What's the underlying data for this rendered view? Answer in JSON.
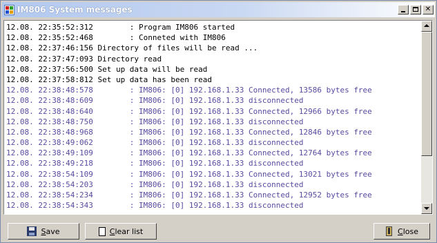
{
  "window": {
    "title": "IM806 System messages"
  },
  "log": {
    "lines": [
      {
        "text": "12.08. 22:35:52:312        : Program IM806 started",
        "color": "black"
      },
      {
        "text": "12.08. 22:35:52:468        : Conneted with IM806",
        "color": "black"
      },
      {
        "text": "12.08. 22:37:46:156 Directory of files will be read ...",
        "color": "black"
      },
      {
        "text": "12.08. 22:37:47:093 Directory read",
        "color": "black"
      },
      {
        "text": "12.08. 22:37:56:500 Set up data will be read",
        "color": "black"
      },
      {
        "text": "12.08. 22:37:58:812 Set up data has been read",
        "color": "black"
      },
      {
        "text": "12.08. 22:38:48:578        : IM806: [0] 192.168.1.33 Connected, 13586 bytes free",
        "color": "purple"
      },
      {
        "text": "12.08. 22:38:48:609        : IM806: [0] 192.168.1.33 disconnected",
        "color": "purple"
      },
      {
        "text": "12.08. 22:38:48:640        : IM806: [0] 192.168.1.33 Connected, 12966 bytes free",
        "color": "purple"
      },
      {
        "text": "12.08. 22:38:48:750        : IM806: [0] 192.168.1.33 disconnected",
        "color": "purple"
      },
      {
        "text": "12.08. 22:38:48:968        : IM806: [0] 192.168.1.33 Connected, 12846 bytes free",
        "color": "purple"
      },
      {
        "text": "12.08. 22:38:49:062        : IM806: [0] 192.168.1.33 disconnected",
        "color": "purple"
      },
      {
        "text": "12.08. 22:38:49:109        : IM806: [0] 192.168.1.33 Connected, 12764 bytes free",
        "color": "purple"
      },
      {
        "text": "12.08. 22:38:49:218        : IM806: [0] 192.168.1.33 disconnected",
        "color": "purple"
      },
      {
        "text": "12.08. 22:38:54:109        : IM806: [0] 192.168.1.33 Connected, 13021 bytes free",
        "color": "purple"
      },
      {
        "text": "12.08. 22:38:54:203        : IM806: [0] 192.168.1.33 disconnected",
        "color": "purple"
      },
      {
        "text": "12.08. 22:38:54:234        : IM806: [0] 192.168.1.33 Connected, 12952 bytes free",
        "color": "purple"
      },
      {
        "text": "12.08. 22:38:54:343        : IM806: [0] 192.168.1.33 disconnected",
        "color": "purple"
      }
    ]
  },
  "buttons": {
    "save": {
      "hotkey": "S",
      "rest": "ave",
      "icon": "floppy-disk-icon"
    },
    "clear": {
      "hotkey": "C",
      "rest": "lear list",
      "icon": "blank-page-icon"
    },
    "close": {
      "hotkey": "C",
      "rest": "lose",
      "icon": "exit-door-icon"
    }
  },
  "colors": {
    "log_text_black": "#000000",
    "log_text_purple": "#5a4aa0",
    "titlebar_start": "#b2c8ef",
    "titlebar_end": "#ffffff"
  }
}
